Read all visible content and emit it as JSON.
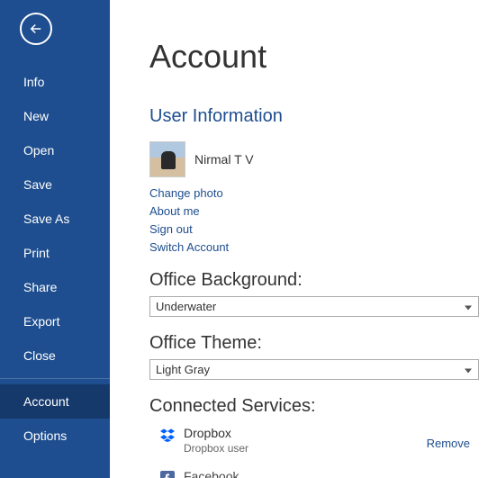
{
  "sidebar": {
    "items": [
      {
        "label": "Info"
      },
      {
        "label": "New"
      },
      {
        "label": "Open"
      },
      {
        "label": "Save"
      },
      {
        "label": "Save As"
      },
      {
        "label": "Print"
      },
      {
        "label": "Share"
      },
      {
        "label": "Export"
      },
      {
        "label": "Close"
      }
    ],
    "bottom_items": [
      {
        "label": "Account"
      },
      {
        "label": "Options"
      }
    ]
  },
  "page": {
    "title": "Account"
  },
  "user_info": {
    "heading": "User Information",
    "name": "Nirmal T V",
    "links": {
      "change_photo": "Change photo",
      "about_me": "About me",
      "sign_out": "Sign out",
      "switch_account": "Switch Account"
    }
  },
  "office_background": {
    "label": "Office Background:",
    "value": "Underwater"
  },
  "office_theme": {
    "label": "Office Theme:",
    "value": "Light Gray"
  },
  "connected_services": {
    "heading": "Connected Services:",
    "services": [
      {
        "name": "Dropbox",
        "sub": "Dropbox user",
        "remove": "Remove"
      },
      {
        "name": "Facebook",
        "sub": ""
      }
    ]
  },
  "colors": {
    "sidebar": "#1e4e8f",
    "accent": "#1e4e8f"
  }
}
